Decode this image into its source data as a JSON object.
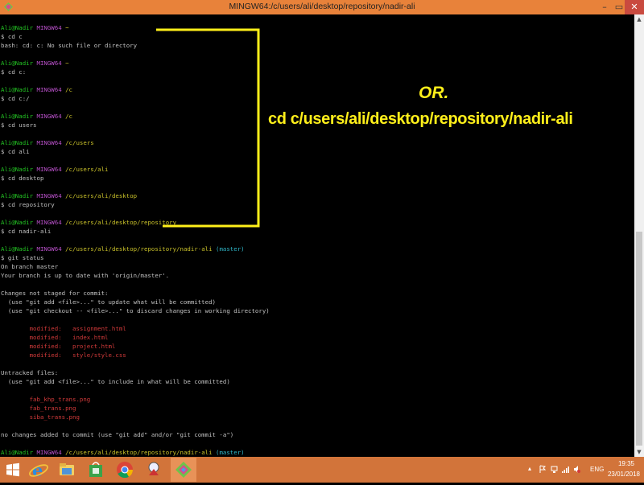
{
  "window": {
    "title": "MINGW64:/c/users/ali/desktop/repository/nadir-ali",
    "minimize": "–",
    "maximize": "▭",
    "close": "✕"
  },
  "terminal": {
    "user": "Ali@Nadir",
    "host": "MINGW64",
    "lines": {
      "l1_path": "~",
      "l2": "$ cd c",
      "l3": "bash: cd: c: No such file or directory",
      "l5_path": "~",
      "l6": "$ cd c:",
      "l8_path": "/c",
      "l9": "$ cd c:/",
      "l11_path": "/c",
      "l12": "$ cd users",
      "l14_path": "/c/users",
      "l15": "$ cd ali",
      "l17_path": "/c/users/ali",
      "l18": "$ cd desktop",
      "l20_path": "/c/users/ali/desktop",
      "l21": "$ cd repository",
      "l23_path": "/c/users/ali/desktop/repository",
      "l24": "$ cd nadir-ali",
      "l26_path": "/c/users/ali/desktop/repository/nadir-ali",
      "l26_branch": "(master)",
      "l27": "$ git status",
      "l28": "On branch master",
      "l29": "Your branch is up to date with 'origin/master'.",
      "l31": "Changes not staged for commit:",
      "l32": "  (use \"git add <file>...\" to update what will be committed)",
      "l33": "  (use \"git checkout -- <file>...\" to discard changes in working directory)",
      "l35": "        modified:   assignment.html",
      "l36": "        modified:   index.html",
      "l37": "        modified:   project.html",
      "l38": "        modified:   style/style.css",
      "l40": "Untracked files:",
      "l41": "  (use \"git add <file>...\" to include in what will be committed)",
      "l43": "        fab_khp_trans.png",
      "l44": "        fab_trans.png",
      "l45": "        siba_trans.png",
      "l47": "no changes added to commit (use \"git add\" and/or \"git commit -a\")",
      "l49_path": "/c/users/ali/desktop/repository/nadir-ali",
      "l49_branch": "(master)"
    }
  },
  "annotation": {
    "or_text": "OR.",
    "command_text": "cd c/users/ali/desktop/repository/nadir-ali",
    "color": "#ffef1a"
  },
  "taskbar": {
    "apps": [
      {
        "name": "start",
        "icon": "windows-logo-icon"
      },
      {
        "name": "internet-explorer",
        "icon": "internet-explorer-icon"
      },
      {
        "name": "file-explorer",
        "icon": "folder-icon"
      },
      {
        "name": "store",
        "icon": "store-bag-icon"
      },
      {
        "name": "chrome",
        "icon": "chrome-icon"
      },
      {
        "name": "app",
        "icon": "app-icon"
      },
      {
        "name": "git-bash",
        "icon": "git-bash-icon"
      }
    ],
    "tray": {
      "chevron": "▴",
      "language": "ENG",
      "time": "19:35",
      "date": "23/01/2018"
    },
    "color": "#d2743a"
  }
}
